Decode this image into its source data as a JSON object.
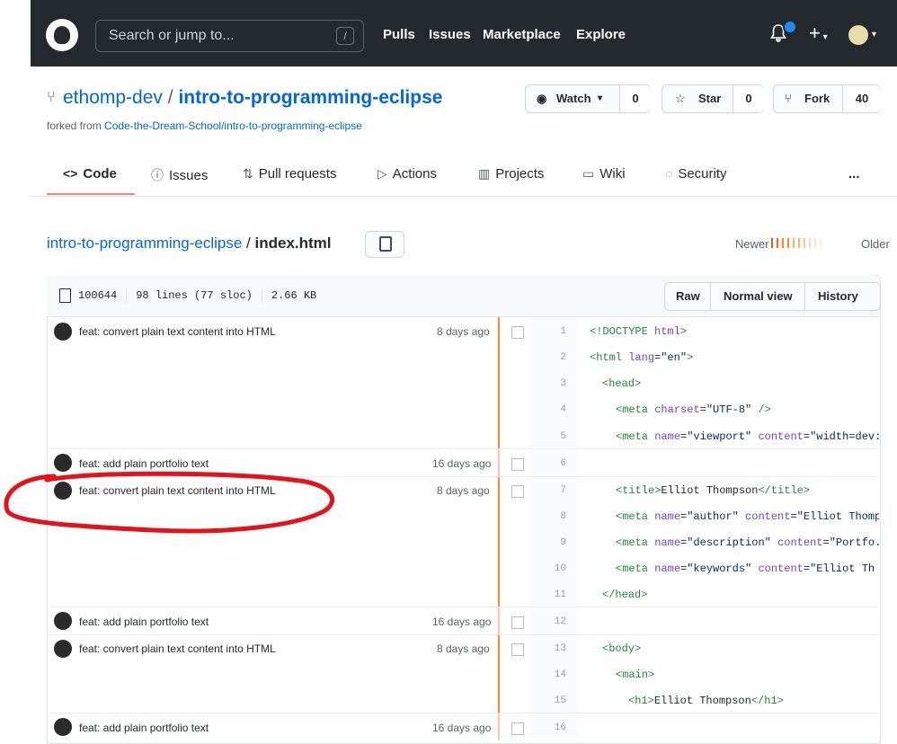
{
  "header": {
    "search_placeholder": "Search or jump to...",
    "search_shortcut": "/",
    "nav": [
      "Pulls",
      "Issues",
      "Marketplace",
      "Explore"
    ]
  },
  "repo": {
    "owner": "ethomp-dev",
    "separator": "/",
    "name": "intro-to-programming-eclipse",
    "forked_prefix": "forked from",
    "forked_link": "Code-the-Dream-School/intro-to-programming-eclipse",
    "watch_label": "Watch",
    "watch_count": "0",
    "star_label": "Star",
    "star_count": "0",
    "fork_label": "Fork",
    "fork_count": "40"
  },
  "tabs": [
    {
      "label": "Code",
      "icon": "code-icon"
    },
    {
      "label": "Issues",
      "icon": "issue-icon"
    },
    {
      "label": "Pull requests",
      "icon": "pull-request-icon"
    },
    {
      "label": "Actions",
      "icon": "play-icon"
    },
    {
      "label": "Projects",
      "icon": "project-icon"
    },
    {
      "label": "Wiki",
      "icon": "book-icon"
    },
    {
      "label": "Security",
      "icon": "shield-icon"
    },
    {
      "label": "..."
    }
  ],
  "breadcrumb": {
    "repo": "intro-to-programming-eclipse",
    "separator": "/",
    "file": "index.html"
  },
  "heat": {
    "newer": "Newer",
    "older": "Older"
  },
  "file": {
    "mode": "100644",
    "lines": "98 lines (77 sloc)",
    "size": "2.66 KB",
    "buttons": [
      "Raw",
      "Normal view",
      "History"
    ]
  },
  "blame": [
    {
      "message": "feat: convert plain text content into HTML",
      "age": "8 days ago"
    },
    {
      "message": "feat: add plain portfolio text",
      "age": "16 days ago"
    },
    {
      "message": "feat: convert plain text content into HTML",
      "age": "8 days ago"
    },
    {
      "message": "feat: add plain portfolio text",
      "age": "16 days ago"
    },
    {
      "message": "feat: convert plain text content into HTML",
      "age": "8 days ago"
    },
    {
      "message": "feat: add plain portfolio text",
      "age": "16 days ago"
    }
  ],
  "code_lines": [
    {
      "n": "1"
    },
    {
      "n": "2"
    },
    {
      "n": "3"
    },
    {
      "n": "4"
    },
    {
      "n": "5"
    },
    {
      "n": "6"
    },
    {
      "n": "7"
    },
    {
      "n": "8"
    },
    {
      "n": "9"
    },
    {
      "n": "10"
    },
    {
      "n": "11"
    },
    {
      "n": "12"
    },
    {
      "n": "13"
    },
    {
      "n": "14"
    },
    {
      "n": "15"
    },
    {
      "n": "16"
    }
  ],
  "code": {
    "l1_a": "<!DOCTYPE ",
    "l1_b": "html",
    "l1_c": ">",
    "l2_a": "<html ",
    "l2_b": "lang",
    "l2_c": "=",
    "l2_d": "\"en\"",
    "l2_e": ">",
    "l3": "<head>",
    "l4_a": "<meta ",
    "l4_b": "charset",
    "l4_c": "=",
    "l4_d": "\"UTF-8\"",
    "l4_e": " />",
    "l5_a": "<meta ",
    "l5_b": "name",
    "l5_c": "=",
    "l5_d": "\"viewport\"",
    "l5_e": " ",
    "l5_f": "content",
    "l5_g": "=",
    "l5_h": "\"width=dev:",
    "l7_a": "<title>",
    "l7_b": "Elliot Thompson",
    "l7_c": "</title>",
    "l8_a": "<meta ",
    "l8_b": "name",
    "l8_c": "=",
    "l8_d": "\"author\"",
    "l8_e": " ",
    "l8_f": "content",
    "l8_g": "=",
    "l8_h": "\"Elliot Thomp",
    "l9_a": "<meta ",
    "l9_b": "name",
    "l9_c": "=",
    "l9_d": "\"description\"",
    "l9_e": " ",
    "l9_f": "content",
    "l9_g": "=",
    "l9_h": "\"Portfo.",
    "l10_a": "<meta ",
    "l10_b": "name",
    "l10_c": "=",
    "l10_d": "\"keywords\"",
    "l10_e": " ",
    "l10_f": "content",
    "l10_g": "=",
    "l10_h": "\"Elliot Th",
    "l11": "</head>",
    "l13": "<body>",
    "l14": "<main>",
    "l15_a": "<h1>",
    "l15_b": "Elliot Thompson",
    "l15_c": "</h1>"
  },
  "colors": {
    "accent": "#f9826c",
    "link": "#0366d6",
    "header_bg": "#24292e",
    "annotation": "#e0151b"
  }
}
